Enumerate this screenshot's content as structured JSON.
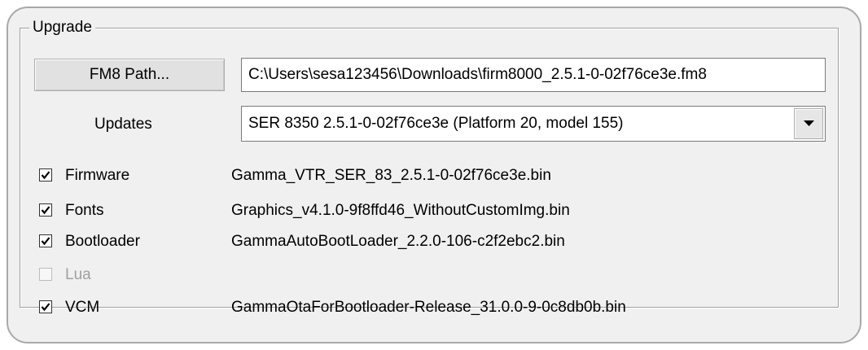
{
  "group": {
    "title": "Upgrade"
  },
  "fm8": {
    "button_label": "FM8 Path...",
    "path_value": "C:\\Users\\sesa123456\\Downloads\\firm8000_2.5.1-0-02f76ce3e.fm8"
  },
  "updates": {
    "label": "Updates",
    "selected": "SER 8350 2.5.1-0-02f76ce3e (Platform 20, model 155)",
    "arrow_icon": "chevron-down-icon"
  },
  "components": [
    {
      "label": "Firmware",
      "checked": true,
      "enabled": true,
      "file": "Gamma_VTR_SER_83_2.5.1-0-02f76ce3e.bin"
    },
    {
      "label": "Fonts",
      "checked": true,
      "enabled": true,
      "file": "Graphics_v4.1.0-9f8ffd46_WithoutCustomImg.bin"
    },
    {
      "label": "Bootloader",
      "checked": true,
      "enabled": true,
      "file": "GammaAutoBootLoader_2.2.0-106-c2f2ebc2.bin"
    },
    {
      "label": "Lua",
      "checked": false,
      "enabled": false,
      "file": ""
    },
    {
      "label": "VCM",
      "checked": true,
      "enabled": true,
      "file": "GammaOtaForBootloader-Release_31.0.0-9-0c8db0b.bin"
    }
  ],
  "colors": {
    "window_bg": "#f0f0f0",
    "disabled_text": "#a0a0a0"
  }
}
